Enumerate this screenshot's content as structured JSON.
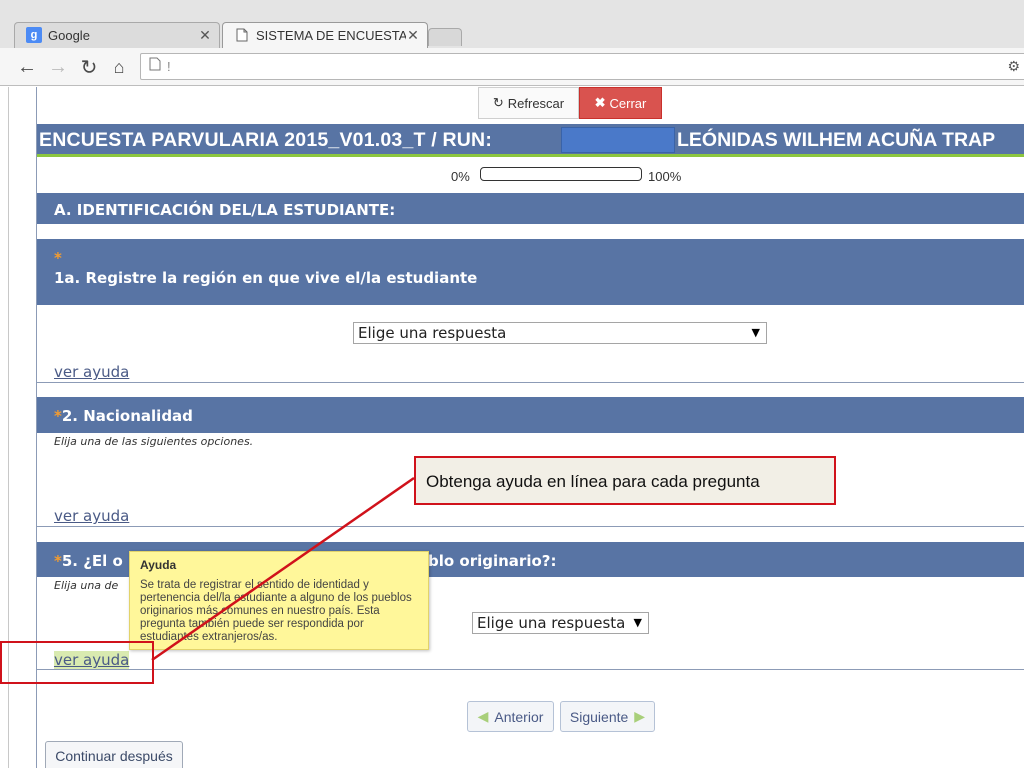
{
  "browser": {
    "tabs": [
      {
        "title": "Google",
        "icon": "google-favicon"
      },
      {
        "title": "SISTEMA DE ENCUESTAS -",
        "icon": "document-icon"
      }
    ],
    "url": "!"
  },
  "top_buttons": {
    "refresh": "Refrescar",
    "close": "Cerrar"
  },
  "survey": {
    "title": "ENCUESTA PARVULARIA 2015_V01.03_T / RUN:",
    "student_name": "LEÓNIDAS WILHEM ACUÑA TRAP",
    "progress": {
      "min_label": "0%",
      "max_label": "100%",
      "value_percent": 0
    },
    "section": "A. IDENTIFICACIÓN DEL/LA ESTUDIANTE:",
    "questions": [
      {
        "required_mark": "*",
        "text": "1a. Registre la región en que vive el/la estudiante",
        "select_value": "Elige una respuesta",
        "help_link": "ver ayuda"
      },
      {
        "required_mark": "*",
        "text": "2. Nacionalidad",
        "hint": "Elija una de las siguientes opciones.",
        "help_link": "ver ayuda"
      },
      {
        "required_mark": "*",
        "text_start": "5. ¿El o",
        "text_end": "blo originario?:",
        "hint": "Elija una de",
        "select_value": "Elige una respuesta",
        "help_link": "ver ayuda"
      }
    ],
    "tooltip": {
      "title": "Ayuda",
      "body": "Se trata de registrar el sentido de identidad y pertenencia del/la estudiante a alguno de los pueblos originarios más comunes en nuestro país. Esta pregunta también puede ser respondida por estudiantes extranjeros/as."
    },
    "nav": {
      "previous": "Anterior",
      "next": "Siguiente",
      "continue_later": "Continuar después"
    }
  },
  "annotation": {
    "callout_text": "Obtenga ayuda en línea para cada pregunta",
    "color": "#d0121b"
  },
  "colors": {
    "header_blue": "#5874a4",
    "accent_green": "#8cc63f",
    "close_red": "#d9534f",
    "tooltip_yellow": "#fff79a",
    "required_orange": "#f39c2f"
  }
}
